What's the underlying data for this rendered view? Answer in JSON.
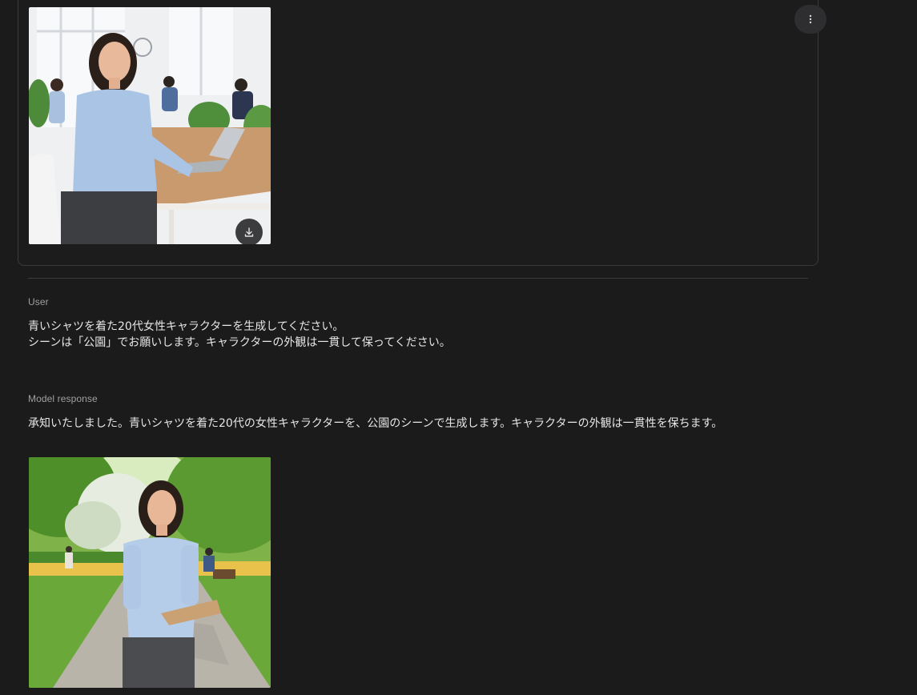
{
  "previous_turn": {
    "more_options_icon": "vertical-ellipsis-icon",
    "image": {
      "subject": "office",
      "download_icon": "download-icon"
    }
  },
  "user_turn": {
    "role": "User",
    "lines": [
      "青いシャツを着た20代女性キャラクターを生成してください。",
      "シーンは「公園」でお願いします。キャラクターの外観は一貫して保ってください。"
    ]
  },
  "model_turn": {
    "role": "Model response",
    "text": "承知いたしました。青いシャツを着た20代の女性キャラクターを、公園のシーンで生成します。キャラクターの外観は一貫性を保ちます。",
    "image": {
      "subject": "park"
    }
  },
  "colors": {
    "background": "#1b1b1c",
    "card_border": "#3a3a3c",
    "label": "#a0a0a3",
    "text": "#e6e6e6"
  }
}
